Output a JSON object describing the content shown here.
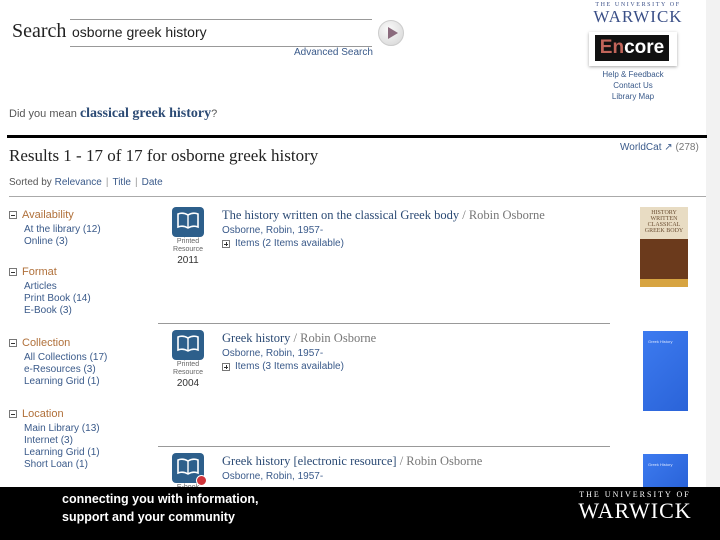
{
  "search": {
    "label": "Search",
    "query": "osborne greek history",
    "advanced_label": "Advanced Search"
  },
  "suggestion": {
    "prefix": "Did you mean",
    "term": "classical greek history",
    "suffix": "?"
  },
  "header_right": {
    "university_small": "THE UNIVERSITY OF",
    "university_name": "WARWICK",
    "encore_en": "En",
    "encore_core": "core",
    "links": [
      "Help & Feedback",
      "Contact Us",
      "Library Map"
    ]
  },
  "results": {
    "title": "Results 1 - 17 of 17 for osborne greek history",
    "sort_label": "Sorted by",
    "sort_options": [
      "Relevance",
      "Title",
      "Date"
    ],
    "worldcat_label": "WorldCat",
    "worldcat_count": "(278)"
  },
  "facets": [
    {
      "heading": "Availability",
      "items": [
        "At the library (12)",
        "Online (3)"
      ]
    },
    {
      "heading": "Format",
      "items": [
        "Articles",
        "Print Book (14)",
        "E-Book (3)"
      ]
    },
    {
      "heading": "Collection",
      "items": [
        "All Collections (17)",
        "e-Resources (3)",
        "Learning Grid (1)"
      ]
    },
    {
      "heading": "Location",
      "items": [
        "Main Library (13)",
        "Internet (3)",
        "Learning Grid (1)",
        "Short Loan (1)"
      ]
    }
  ],
  "items": [
    {
      "title": "The history written on the classical Greek body",
      "author_suffix": "/ Robin Osborne",
      "author": "Osborne, Robin, 1957-",
      "type_line1": "Printed",
      "type_line2": "Resource",
      "year": "2011",
      "items_text": "Items (2 Items available)",
      "cover_text": "HISTORY WRITTEN CLASSICAL GREEK BODY"
    },
    {
      "title": "Greek history",
      "author_suffix": "/ Robin Osborne",
      "author": "Osborne, Robin, 1957-",
      "type_line1": "Printed",
      "type_line2": "Resource",
      "year": "2004",
      "items_text": "Items (3 Items available)",
      "cover_text": "Greek History"
    },
    {
      "title": "Greek history [electronic resource]",
      "author_suffix": "/ Robin Osborne",
      "author": "Osborne, Robin, 1957-",
      "type_line1": "E-book",
      "cover_text": "Greek History"
    }
  ],
  "footer": {
    "line1": "connecting you with information,",
    "line2": "support and your community",
    "university_small": "THE UNIVERSITY OF",
    "university_name": "WARWICK"
  }
}
